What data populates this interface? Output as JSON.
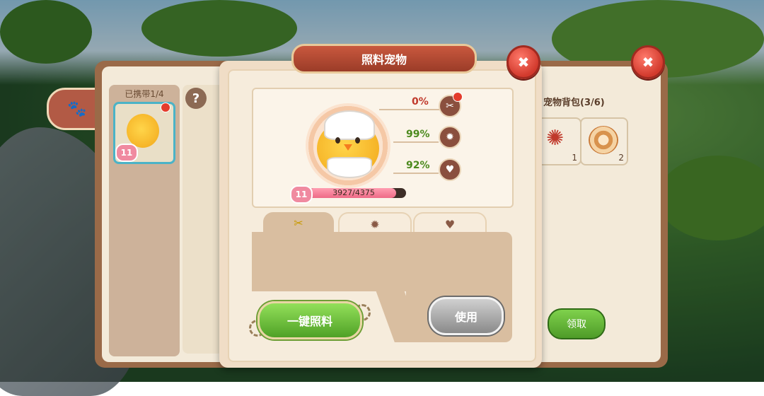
{
  "back_panel": {
    "carried_label": "已携带1/4",
    "help_icon": "?",
    "pet_bag_label": "宠物背包(3/6)",
    "bag_items": [
      {
        "icon": "crab-icon",
        "count": "1"
      },
      {
        "icon": "bread-roll-icon",
        "count": "2"
      }
    ],
    "claim_label": "领取",
    "slot_pet_level": "11"
  },
  "modal": {
    "title": "照料宠物",
    "close_icon": "✖",
    "stats": [
      {
        "icon": "food-icon",
        "value": "0%",
        "color": "#c0392b"
      },
      {
        "icon": "sun-icon",
        "value": "99%",
        "color": "#4c8a1e"
      },
      {
        "icon": "heart-icon",
        "value": "92%",
        "color": "#4c8a1e"
      }
    ],
    "pet_level": "11",
    "exp_text": "3927/4375",
    "exp_fraction": 0.8975,
    "tabs": [
      {
        "icon": "food-icon",
        "glyph": "✂"
      },
      {
        "icon": "sun-icon",
        "glyph": "✹"
      },
      {
        "icon": "heart-icon",
        "glyph": "♥"
      }
    ],
    "feed_all_label": "一键照料",
    "use_label": "使用"
  },
  "colors": {
    "accent_green": "#5fb02f",
    "accent_red": "#d23a2d",
    "brown": "#8a4f3e"
  }
}
